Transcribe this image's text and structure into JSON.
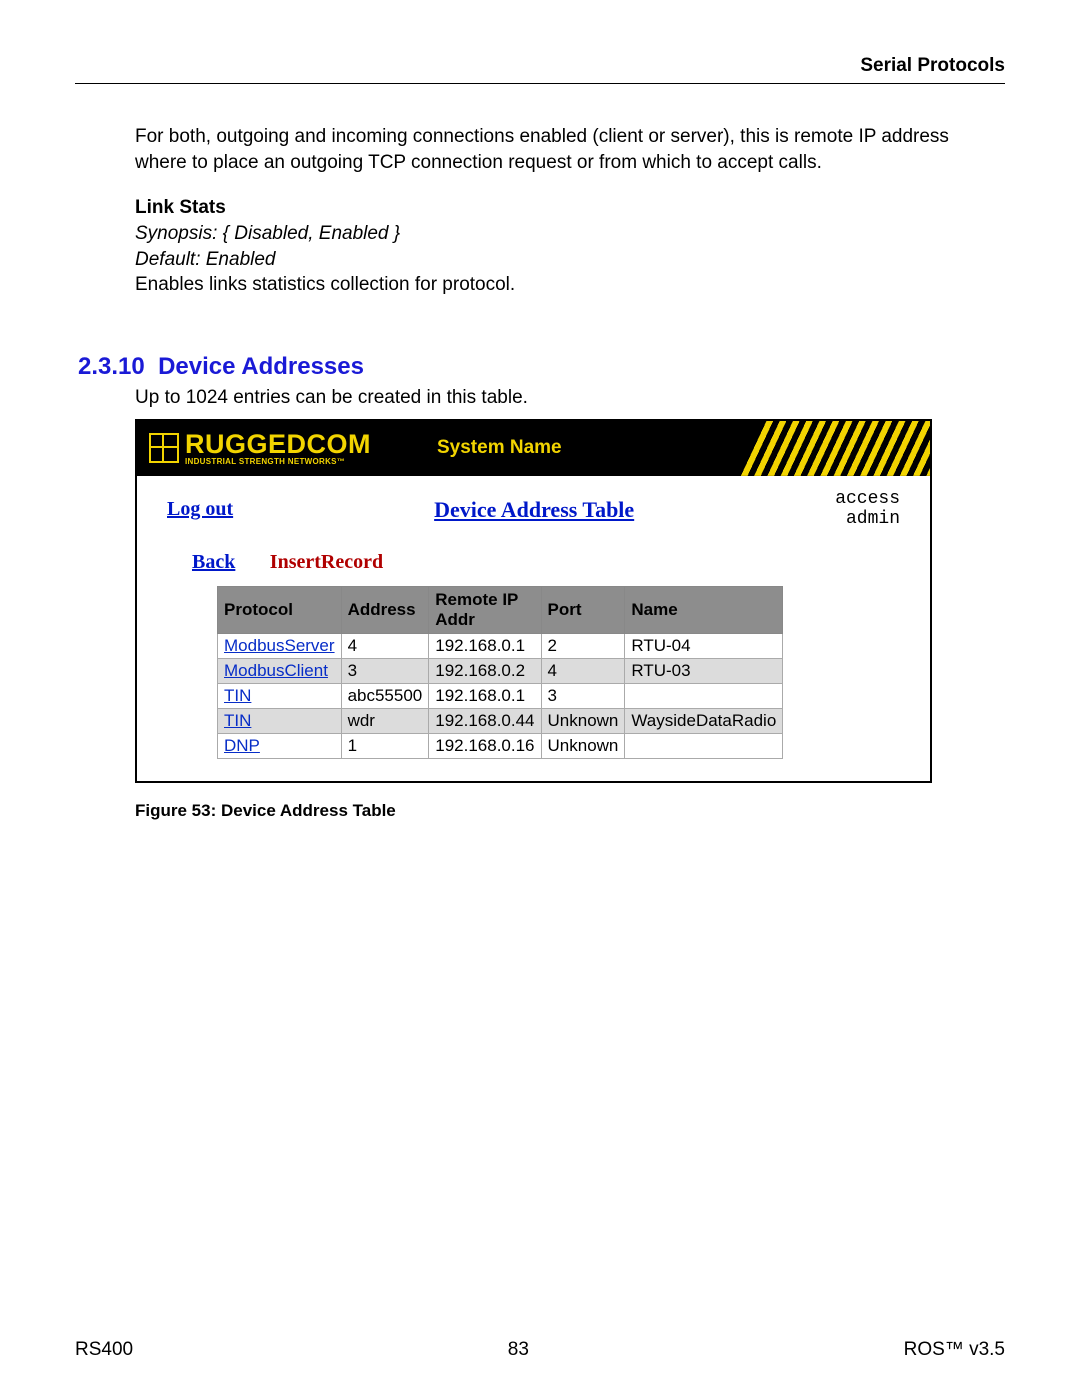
{
  "header": {
    "title": "Serial Protocols"
  },
  "intro_para": "For both, outgoing and incoming connections enabled (client or server), this is remote IP address where to place an outgoing TCP connection request or from which to accept calls.",
  "linkstats": {
    "heading": "Link Stats",
    "synopsis": "Synopsis: { Disabled, Enabled }",
    "default": "Default: Enabled",
    "desc": "Enables links statistics collection for protocol."
  },
  "section": {
    "num": "2.3.10",
    "title": "Device Addresses",
    "intro": "Up to 1024 entries can be created in this table."
  },
  "app": {
    "logo_main": "RUGGEDCOM",
    "logo_sub": "INDUSTRIAL STRENGTH NETWORKS™",
    "system_name": "System Name",
    "logout": "Log out",
    "page_title": "Device Address Table",
    "access_line1": "access",
    "access_line2": "admin",
    "back": "Back",
    "insert": "InsertRecord",
    "columns": [
      "Protocol",
      "Address",
      "Remote IP Addr",
      "Port",
      "Name"
    ],
    "rows": [
      {
        "protocol": "ModbusServer",
        "address": "4",
        "remote": "192.168.0.1",
        "port": "2",
        "name": "RTU-04"
      },
      {
        "protocol": "ModbusClient",
        "address": "3",
        "remote": "192.168.0.2",
        "port": "4",
        "name": "RTU-03"
      },
      {
        "protocol": "TIN",
        "address": "abc55500",
        "remote": "192.168.0.1",
        "port": "3",
        "name": ""
      },
      {
        "protocol": "TIN",
        "address": "wdr",
        "remote": "192.168.0.44",
        "port": "Unknown",
        "name": "WaysideDataRadio"
      },
      {
        "protocol": "DNP",
        "address": "1",
        "remote": "192.168.0.16",
        "port": "Unknown",
        "name": ""
      }
    ]
  },
  "figure_caption": "Figure 53: Device Address Table",
  "footer": {
    "left": "RS400",
    "center": "83",
    "right": "ROS™  v3.5"
  }
}
